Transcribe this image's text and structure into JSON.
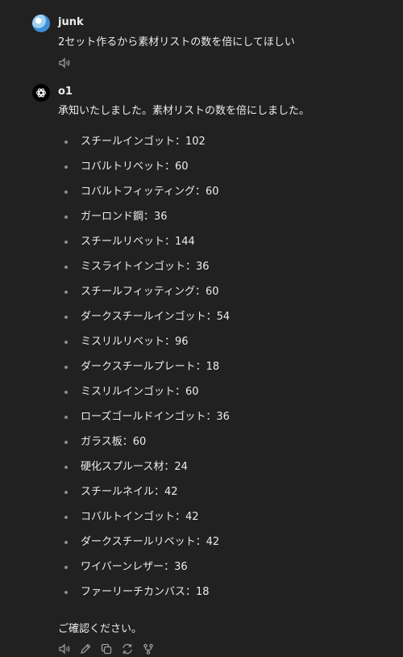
{
  "user_message": {
    "author": "junk",
    "text": "2セット作るから素材リストの数を倍にしてほしい"
  },
  "assistant_message": {
    "author": "o1",
    "intro": "承知いたしました。素材リストの数を倍にしました。",
    "items": [
      "スチールインゴット：102",
      "コバルトリベット：60",
      "コバルトフィッティング：60",
      "ガーロンド鋼：36",
      "スチールリベット：144",
      "ミスライトインゴット：36",
      "スチールフィッティング：60",
      "ダークスチールインゴット：54",
      "ミスリルリベット：96",
      "ダークスチールプレート：18",
      "ミスリルインゴット：60",
      "ローズゴールドインゴット：36",
      "ガラス板：60",
      "硬化スプルース材：24",
      "スチールネイル：42",
      "コバルトインゴット：42",
      "ダークスチールリベット：42",
      "ワイバーンレザー：36",
      "ファーリーチカンバス：18"
    ],
    "closing": "ご確認ください。"
  },
  "icons": {
    "user_actions": [
      "speaker-icon"
    ],
    "assistant_actions": [
      "speaker-icon",
      "edit-icon",
      "copy-icon",
      "regenerate-icon",
      "branch-icon"
    ]
  },
  "colors": {
    "background": "#212121",
    "text": "#ececec",
    "muted": "#8e8e8e"
  }
}
